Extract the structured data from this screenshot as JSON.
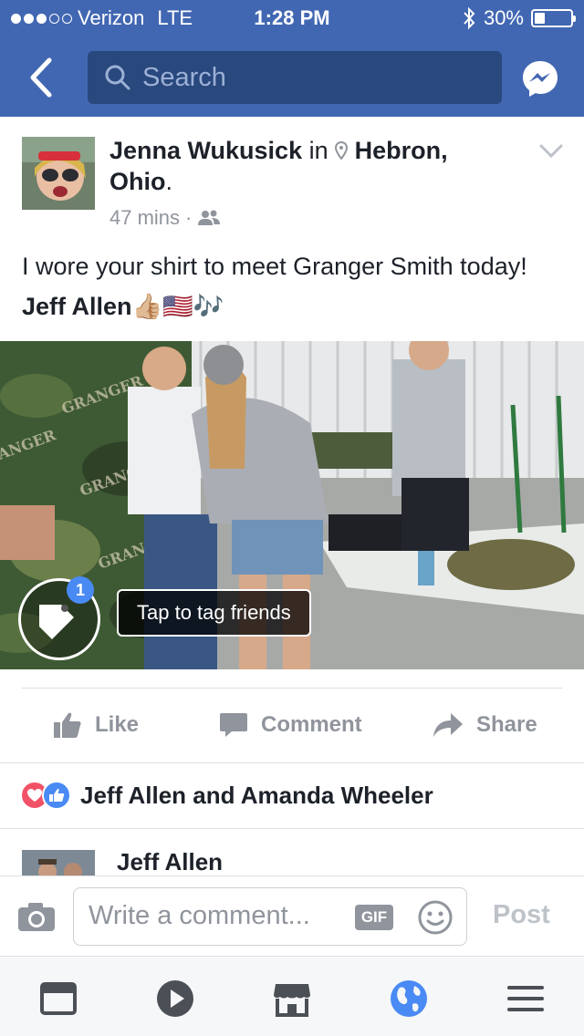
{
  "status_bar": {
    "carrier": "Verizon",
    "network": "LTE",
    "time": "1:28 PM",
    "battery_percent": "30%",
    "battery_level": 0.3
  },
  "nav": {
    "search_placeholder": "Search"
  },
  "post": {
    "author": "Jenna Wukusick",
    "in_word": "in",
    "location": "Hebron, Ohio",
    "time_ago": "47 mins",
    "text_before": "I wore your shirt to meet Granger Smith today!",
    "tagged": "Jeff Allen",
    "emojis": "👍🏼🇺🇸🎶"
  },
  "photo": {
    "tag_count": "1",
    "tag_tooltip": "Tap to tag friends"
  },
  "actions": {
    "like": "Like",
    "comment": "Comment",
    "share": "Share"
  },
  "reactions": {
    "names": "Jeff Allen and Amanda Wheeler",
    "love_color": "#f25268",
    "like_color": "#4a8af4"
  },
  "comments": {
    "first_author": "Jeff Allen"
  },
  "composer": {
    "placeholder": "Write a comment...",
    "gif_label": "GIF",
    "post_label": "Post"
  },
  "colors": {
    "brand_blue": "#4267b2",
    "search_bg": "#29487d",
    "globe_active": "#4a8af4",
    "icon_gray": "#4b4f56"
  }
}
